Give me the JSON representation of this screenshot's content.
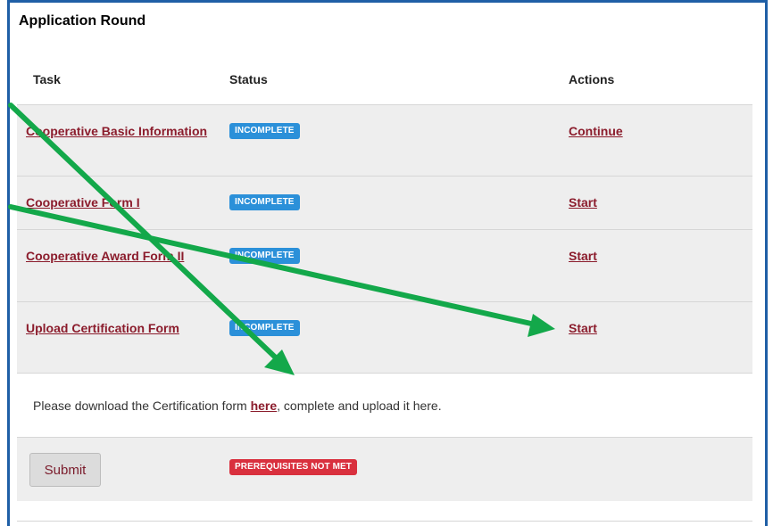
{
  "section_title": "Application Round",
  "table": {
    "headers": {
      "task": "Task",
      "status": "Status",
      "actions": "Actions"
    },
    "rows": [
      {
        "task": "Cooperative Basic Information",
        "status": "INCOMPLETE",
        "action": "Continue"
      },
      {
        "task": "Cooperative Form I",
        "status": "INCOMPLETE",
        "action": "Start"
      },
      {
        "task": "Cooperative Award Form II",
        "status": "INCOMPLETE",
        "action": "Start"
      },
      {
        "task": "Upload Certification Form",
        "status": "INCOMPLETE",
        "action": "Start"
      }
    ]
  },
  "note": {
    "before": "Please download the Certification form ",
    "link": "here",
    "after": ", complete and upload it here."
  },
  "submit": {
    "label": "Submit",
    "status": "PREREQUISITES NOT MET"
  },
  "colors": {
    "link": "#8b1c2c",
    "badge_incomplete": "#2b90d9",
    "badge_prereq": "#d9303e",
    "annotation_arrow": "#13a84a",
    "frame_border": "#1f5fa6"
  }
}
